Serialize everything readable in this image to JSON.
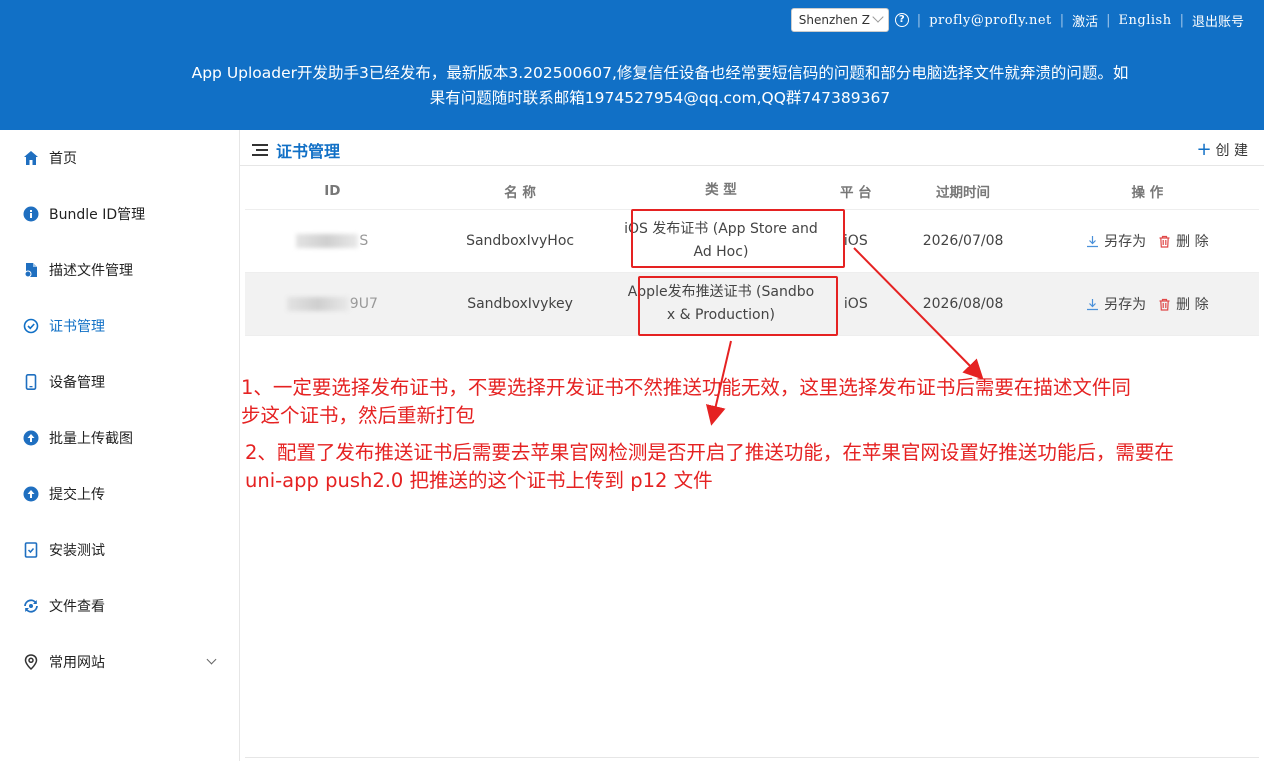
{
  "header": {
    "account_select": "Shenzhen Z",
    "help_label": "?",
    "email": "profly@profly.net",
    "activate": "激活",
    "english": "English",
    "logout": "退出账号",
    "notice_line1": "App Uploader开发助手3已经发布，最新版本3.202500607,修复信任设备也经常要短信码的问题和部分电脑选择文件就奔溃的问题。如",
    "notice_line2": "果有问题随时联系邮箱1974527954@qq.com,QQ群747389367",
    "bg_color": "#1170c6"
  },
  "sidebar": {
    "items": [
      {
        "label": "首页",
        "icon": "home-icon"
      },
      {
        "label": "Bundle ID管理",
        "icon": "info-icon"
      },
      {
        "label": "描述文件管理",
        "icon": "file-icon"
      },
      {
        "label": "证书管理",
        "icon": "certificate-icon",
        "active": true
      },
      {
        "label": "设备管理",
        "icon": "phone-icon"
      },
      {
        "label": "批量上传截图",
        "icon": "upload-icon"
      },
      {
        "label": "提交上传",
        "icon": "upload-circle-icon"
      },
      {
        "label": "安装测试",
        "icon": "install-icon"
      },
      {
        "label": "文件查看",
        "icon": "sync-icon"
      },
      {
        "label": "常用网站",
        "icon": "location-icon"
      }
    ]
  },
  "main": {
    "title": "证书管理",
    "create_label": "创 建",
    "columns": [
      "ID",
      "名 称",
      "类 型",
      "平 台",
      "过期时间",
      "操 作"
    ],
    "rows": [
      {
        "id_visible": "S",
        "name": "SandboxIvyHoc",
        "type_line1": "iOS 发布证书 (App Store and",
        "type_line2": "Ad Hoc)",
        "platform": "iOS",
        "expires": "2026/07/08",
        "save_as": "另存为",
        "delete": "删 除"
      },
      {
        "id_visible": "9U7",
        "name": "SandboxIvykey",
        "type_line1": "Apple发布推送证书 (Sandbo",
        "type_line2": "x & Production)",
        "platform": "iOS",
        "expires": "2026/08/08",
        "save_as": "另存为",
        "delete": "删 除"
      }
    ]
  },
  "annotations": {
    "note1_line1": "1、一定要选择发布证书，不要选择开发证书不然推送功能无效，这里选择发布证书后需要在描述文件同",
    "note1_line2": "步这个证书，然后重新打包",
    "note2_line1": "2、配置了发布推送证书后需要去苹果官网检测是否开启了推送功能，在苹果官网设置好推送功能后，需要在",
    "note2_line2": "uni-app push2.0 把推送的这个证书上传到 p12 文件",
    "color": "#e52222"
  }
}
